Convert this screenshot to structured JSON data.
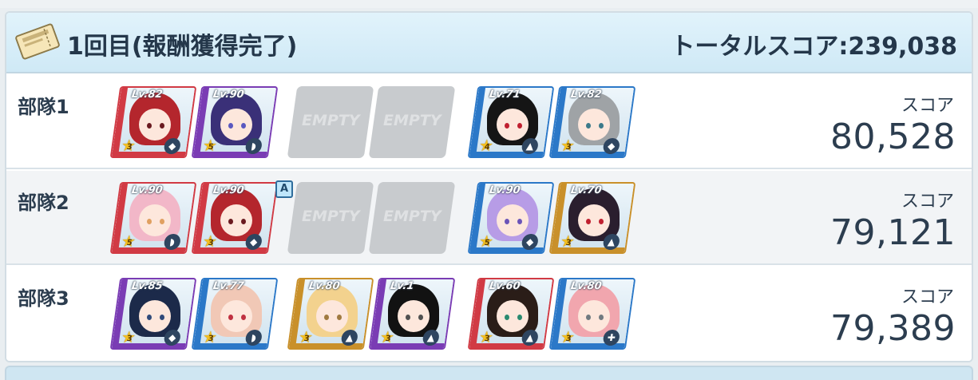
{
  "header": {
    "title": "1回目(報酬獲得完了)",
    "total_score": "トータルスコア:239,038"
  },
  "colors": {
    "header_bg": "#d3ecf8",
    "empty_slot": "#c8cbce"
  },
  "score_caption": "スコア",
  "empty_label": "EMPTY",
  "teams": [
    {
      "label": "部隊1",
      "score": "80,528",
      "slots": [
        {
          "lv": "Lv.82",
          "stars": "3",
          "role": "◆",
          "hair": "#b4262d",
          "eye": "#6a1a20",
          "frame": "#d13a44"
        },
        {
          "lv": "Lv.90",
          "stars": "5",
          "role": "◗",
          "hair": "#3a3078",
          "eye": "#5a58c0",
          "frame": "#7a3cb4"
        },
        {
          "empty": true
        },
        {
          "empty": true
        },
        {
          "lv": "Lv.71",
          "stars": "4",
          "role": "▲",
          "hair": "#151515",
          "eye": "#c02030",
          "frame": "#2b78c8"
        },
        {
          "lv": "Lv.82",
          "stars": "3",
          "role": "◆",
          "hair": "#9fa3a6",
          "eye": "#3c7a8a",
          "frame": "#2b78c8"
        }
      ]
    },
    {
      "label": "部隊2",
      "score": "79,121",
      "assist": "A",
      "slots": [
        {
          "lv": "Lv.90",
          "stars": "5",
          "role": "◗",
          "hair": "#f2b7c8",
          "eye": "#e0a060",
          "frame": "#d13a44"
        },
        {
          "lv": "Lv.90",
          "stars": "3",
          "role": "◆",
          "hair": "#b4262d",
          "eye": "#6a1a20",
          "frame": "#d13a44"
        },
        {
          "empty": true
        },
        {
          "empty": true
        },
        {
          "lv": "Lv.90",
          "stars": "5",
          "role": "◆",
          "hair": "#b79ce6",
          "eye": "#6b54b8",
          "frame": "#2b78c8"
        },
        {
          "lv": "Lv.70",
          "stars": "3",
          "role": "▲",
          "hair": "#2a1e2e",
          "eye": "#c02030",
          "frame": "#c9902a"
        }
      ]
    },
    {
      "label": "部隊3",
      "score": "79,389",
      "slots": [
        {
          "lv": "Lv.85",
          "stars": "3",
          "role": "◆",
          "hair": "#1c2a4a",
          "eye": "#304a7a",
          "frame": "#7a3cb4"
        },
        {
          "lv": "Lv.77",
          "stars": "3",
          "role": "◗",
          "hair": "#f1c8b6",
          "eye": "#c03040",
          "frame": "#2b78c8"
        },
        {
          "lv": "Lv.80",
          "stars": "3",
          "role": "▲",
          "hair": "#f3d28e",
          "eye": "#a07a40",
          "frame": "#c9902a"
        },
        {
          "lv": "Lv.1",
          "stars": "3",
          "role": "▲",
          "hair": "#121212",
          "eye": "#505050",
          "frame": "#7a3cb4"
        },
        {
          "lv": "Lv.60",
          "stars": "3",
          "role": "▲",
          "hair": "#2a1d18",
          "eye": "#2a8a70",
          "frame": "#d13a44"
        },
        {
          "lv": "Lv.80",
          "stars": "3",
          "role": "✚",
          "hair": "#f1a6ae",
          "eye": "#707a80",
          "frame": "#2b78c8"
        }
      ]
    }
  ]
}
